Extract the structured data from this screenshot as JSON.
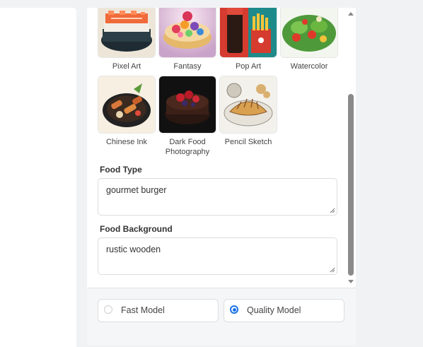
{
  "styles": [
    {
      "label": "Pixel Art",
      "icon": "pixel-art-sushi-thumbnail"
    },
    {
      "label": "Fantasy",
      "icon": "fantasy-tart-thumbnail"
    },
    {
      "label": "Pop Art",
      "icon": "pop-art-soda-fries-thumbnail"
    },
    {
      "label": "Watercolor",
      "icon": "watercolor-salad-thumbnail"
    },
    {
      "label": "Chinese Ink",
      "icon": "chinese-ink-platter-thumbnail"
    },
    {
      "label": "Dark Food Photography",
      "icon": "dark-food-photography-cake-thumbnail"
    },
    {
      "label": "Pencil Sketch",
      "icon": "pencil-sketch-croissant-thumbnail"
    }
  ],
  "food_type": {
    "label": "Food Type",
    "value": "gourmet burger"
  },
  "food_background": {
    "label": "Food Background",
    "value": "rustic wooden"
  },
  "model": {
    "options": [
      {
        "label": "Fast Model",
        "selected": false
      },
      {
        "label": "Quality Model",
        "selected": true
      }
    ],
    "accent": "#1a73e8"
  }
}
